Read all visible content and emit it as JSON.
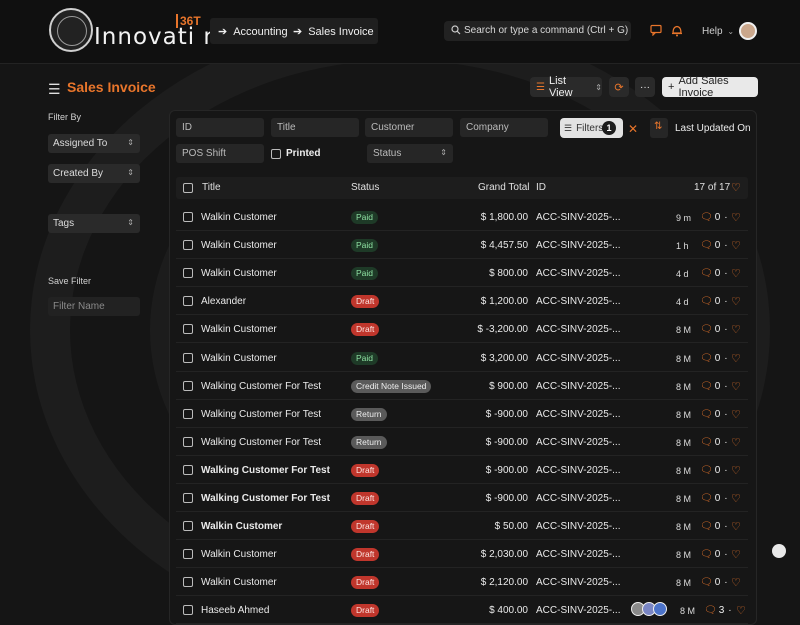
{
  "brand": {
    "name": "Innovati n",
    "sup": "36T"
  },
  "breadcrumbs": [
    {
      "label": "Accounting"
    },
    {
      "label": "Sales Invoice"
    }
  ],
  "search": {
    "placeholder": "Search or type a command (Ctrl + G)"
  },
  "navbar": {
    "help_label": "Help"
  },
  "page": {
    "title": "Sales Invoice",
    "list_view_label": "List View",
    "add_label": "Add Sales Invoice"
  },
  "sidebar": {
    "filter_by": "Filter By",
    "assigned_to": "Assigned To",
    "created_by": "Created By",
    "tags": "Tags",
    "save_filter": "Save Filter",
    "filter_name_placeholder": "Filter Name"
  },
  "filters": {
    "id_placeholder": "ID",
    "title_placeholder": "Title",
    "customer_placeholder": "Customer",
    "company_placeholder": "Company",
    "pos_shift_placeholder": "POS Shift",
    "printed_label": "Printed",
    "status_placeholder": "Status",
    "filters_label": "Filters",
    "filters_count": "1",
    "sort_label": "Last Updated On"
  },
  "table": {
    "headers": {
      "title": "Title",
      "status": "Status",
      "grand_total": "Grand Total",
      "id": "ID",
      "count": "17 of 17"
    },
    "rows": [
      {
        "title": "Walkin Customer",
        "bold": false,
        "status": "Paid",
        "status_type": "paid",
        "total": "$ 1,800.00",
        "id": "ACC-SINV-2025-...",
        "ago": "9 m",
        "comments": "0"
      },
      {
        "title": "Walkin Customer",
        "bold": false,
        "status": "Paid",
        "status_type": "paid",
        "total": "$ 4,457.50",
        "id": "ACC-SINV-2025-...",
        "ago": "1 h",
        "comments": "0"
      },
      {
        "title": "Walkin Customer",
        "bold": false,
        "status": "Paid",
        "status_type": "paid",
        "total": "$ 800.00",
        "id": "ACC-SINV-2025-...",
        "ago": "4 d",
        "comments": "0"
      },
      {
        "title": "Alexander",
        "bold": false,
        "status": "Draft",
        "status_type": "draft",
        "total": "$ 1,200.00",
        "id": "ACC-SINV-2025-...",
        "ago": "4 d",
        "comments": "0"
      },
      {
        "title": "Walkin Customer",
        "bold": false,
        "status": "Draft",
        "status_type": "draft",
        "total": "$ -3,200.00",
        "id": "ACC-SINV-2025-...",
        "ago": "8 M",
        "comments": "0"
      },
      {
        "title": "Walkin Customer",
        "bold": false,
        "status": "Paid",
        "status_type": "paid",
        "total": "$ 3,200.00",
        "id": "ACC-SINV-2025-...",
        "ago": "8 M",
        "comments": "0"
      },
      {
        "title": "Walking Customer For Test",
        "bold": false,
        "status": "Credit Note Issued",
        "status_type": "credit",
        "total": "$ 900.00",
        "id": "ACC-SINV-2025-...",
        "ago": "8 M",
        "comments": "0"
      },
      {
        "title": "Walking Customer For Test",
        "bold": false,
        "status": "Return",
        "status_type": "return",
        "total": "$ -900.00",
        "id": "ACC-SINV-2025-...",
        "ago": "8 M",
        "comments": "0"
      },
      {
        "title": "Walking Customer For Test",
        "bold": false,
        "status": "Return",
        "status_type": "return",
        "total": "$ -900.00",
        "id": "ACC-SINV-2025-...",
        "ago": "8 M",
        "comments": "0"
      },
      {
        "title": "Walking Customer For Test",
        "bold": true,
        "status": "Draft",
        "status_type": "draft",
        "total": "$ -900.00",
        "id": "ACC-SINV-2025-...",
        "ago": "8 M",
        "comments": "0"
      },
      {
        "title": "Walking Customer For Test",
        "bold": true,
        "status": "Draft",
        "status_type": "draft",
        "total": "$ -900.00",
        "id": "ACC-SINV-2025-...",
        "ago": "8 M",
        "comments": "0"
      },
      {
        "title": "Walkin Customer",
        "bold": true,
        "status": "Draft",
        "status_type": "draft",
        "total": "$ 50.00",
        "id": "ACC-SINV-2025-...",
        "ago": "8 M",
        "comments": "0"
      },
      {
        "title": "Walkin Customer",
        "bold": false,
        "status": "Draft",
        "status_type": "draft",
        "total": "$ 2,030.00",
        "id": "ACC-SINV-2025-...",
        "ago": "8 M",
        "comments": "0"
      },
      {
        "title": "Walkin Customer",
        "bold": false,
        "status": "Draft",
        "status_type": "draft",
        "total": "$ 2,120.00",
        "id": "ACC-SINV-2025-...",
        "ago": "8 M",
        "comments": "0"
      },
      {
        "title": "Haseeb Ahmed",
        "bold": false,
        "status": "Draft",
        "status_type": "draft",
        "total": "$ 400.00",
        "id": "ACC-SINV-2025-...",
        "ago": "8 M",
        "comments": "3",
        "avatars": true
      }
    ]
  },
  "colors": {
    "accent": "#e8752b",
    "paid_bg": "#1e3a27",
    "draft_bg": "#c0362c"
  },
  "icons": [
    "search-icon",
    "chat-icon",
    "bell-icon",
    "chevron-down-icon",
    "hamburger-icon",
    "refresh-icon",
    "more-icon",
    "plus-icon",
    "filter-icon",
    "sort-icon",
    "heart-icon",
    "comment-icon"
  ]
}
